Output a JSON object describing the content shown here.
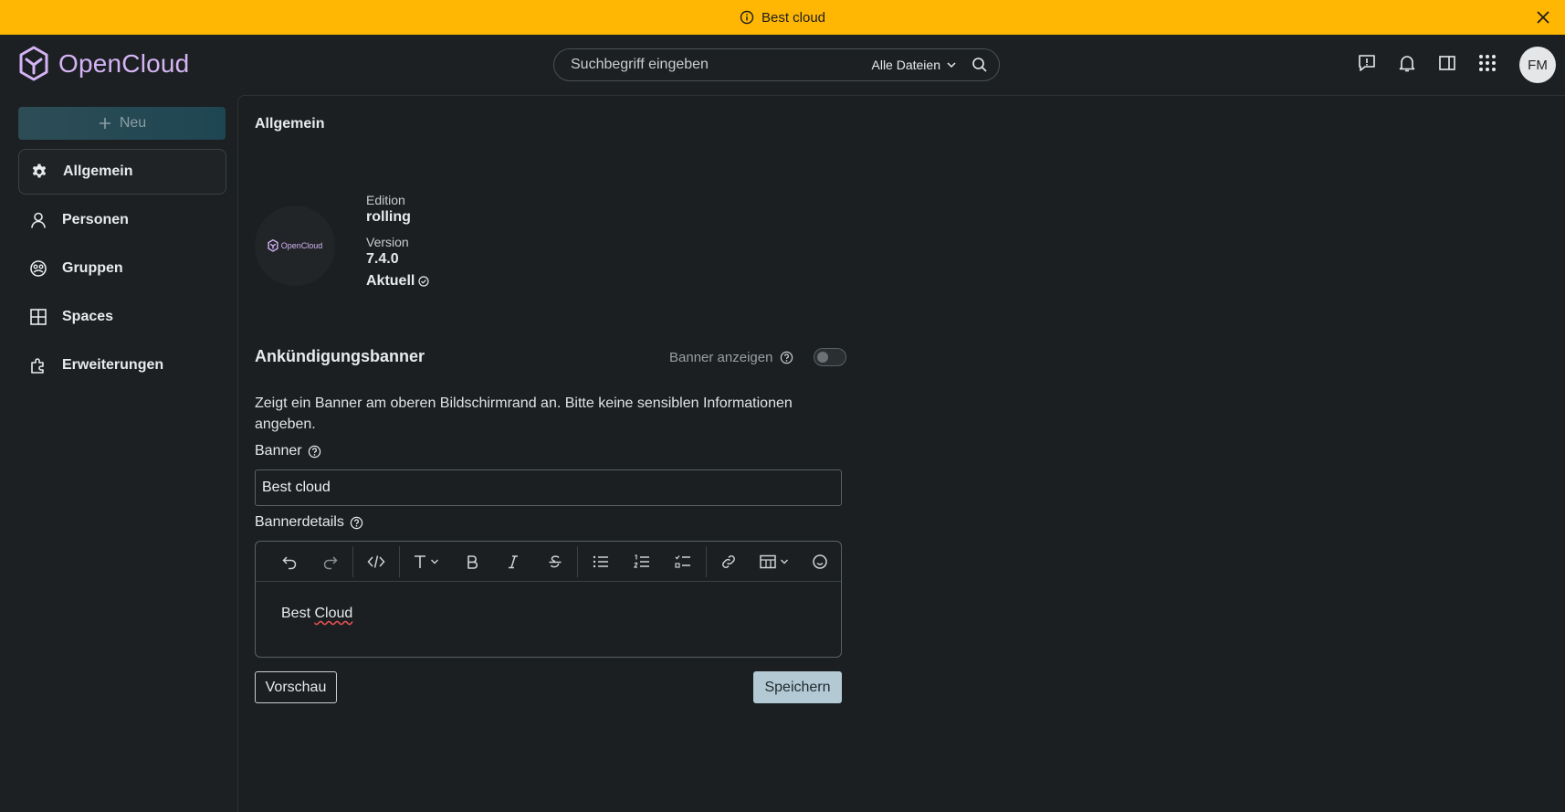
{
  "announcement": {
    "text": "Best cloud",
    "icon": "info-icon",
    "close_icon": "close-icon"
  },
  "header": {
    "brand": "OpenCloud",
    "search": {
      "placeholder": "Suchbegriff eingeben",
      "scope": "Alle Dateien"
    },
    "icons": [
      "feedback-icon",
      "bell-icon",
      "sidebar-toggle-icon",
      "app-grid-icon"
    ],
    "avatar": "FM"
  },
  "sidebar": {
    "new_label": "Neu",
    "items": [
      {
        "label": "Allgemein",
        "icon": "gear-icon",
        "active": true
      },
      {
        "label": "Personen",
        "icon": "user-icon",
        "active": false
      },
      {
        "label": "Gruppen",
        "icon": "groups-icon",
        "active": false
      },
      {
        "label": "Spaces",
        "icon": "grid-icon",
        "active": false
      },
      {
        "label": "Erweiterungen",
        "icon": "puzzle-icon",
        "active": false
      }
    ]
  },
  "main": {
    "title": "Allgemein",
    "logo_text": "OpenCloud",
    "edition_label": "Edition",
    "edition_value": "rolling",
    "version_label": "Version",
    "version_value": "7.4.0",
    "status": "Aktuell",
    "banner_section": {
      "title": "Ankündigungsbanner",
      "toggle_label": "Banner anzeigen",
      "toggle_on": false,
      "description": "Zeigt ein Banner am oberen Bildschirmrand an. Bitte keine sensiblen Informationen angeben.",
      "banner_label": "Banner",
      "banner_value": "Best cloud",
      "details_label": "Bannerdetails",
      "editor_word1": "Best",
      "editor_word2": "Cloud",
      "preview_label": "Vorschau",
      "save_label": "Speichern"
    }
  },
  "colors": {
    "banner": "#ffb703",
    "brand": "#d5b3f5",
    "save": "#b3c9d4",
    "background": "#1c2022"
  }
}
